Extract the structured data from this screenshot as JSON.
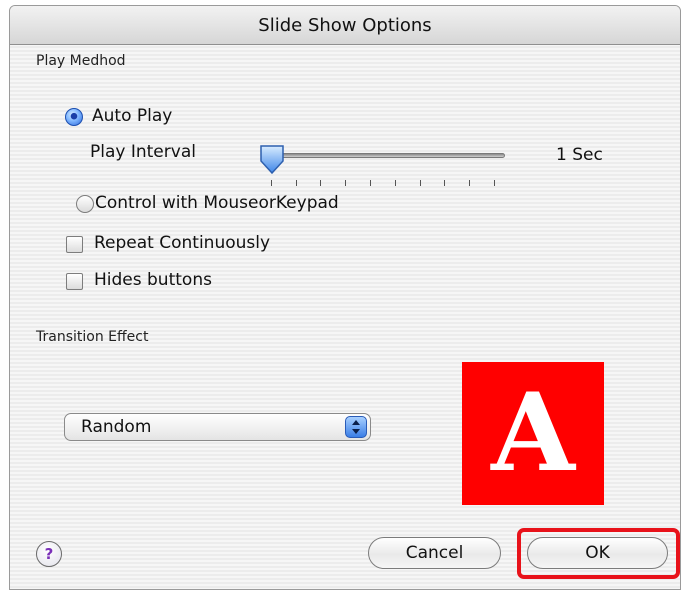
{
  "window": {
    "title": "Slide Show Options"
  },
  "play_method": {
    "section_label": "Play Medhod",
    "auto_play_label": "Auto Play",
    "auto_play_selected": true,
    "play_interval_label": "Play Interval",
    "interval_value": "1 Sec",
    "control_label": "Control with MouseorKeypad",
    "control_selected": false,
    "repeat_label": "Repeat Continuously",
    "repeat_checked": false,
    "hide_buttons_label": "Hides buttons",
    "hide_buttons_checked": false
  },
  "transition": {
    "section_label": "Transition Effect",
    "selected_effect": "Random",
    "preview_letter": "A",
    "preview_color": "#ff0000"
  },
  "buttons": {
    "help": "?",
    "cancel": "Cancel",
    "ok": "OK"
  },
  "colors": {
    "accent": "#3a7ee6",
    "highlight": "#e8121a"
  },
  "icons": {
    "help": "help-icon",
    "popup_arrows": "popup-arrows-icon",
    "slider_thumb": "slider-thumb-icon"
  }
}
